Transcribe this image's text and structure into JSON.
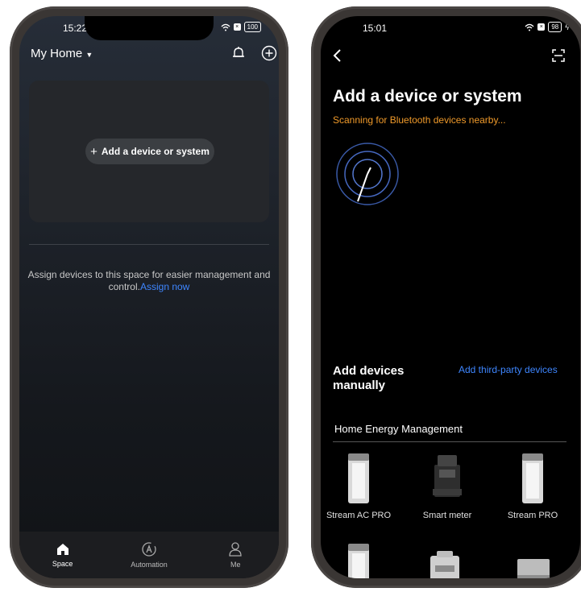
{
  "left_phone": {
    "status_time": "15:22",
    "battery": "100",
    "home_title": "My Home",
    "add_button_label": "Add a device or system",
    "assign_text": "Assign devices to this space for easier management and control.",
    "assign_link": "Assign now",
    "tabs": [
      {
        "label": "Space",
        "icon": "home-icon"
      },
      {
        "label": "Automation",
        "icon": "automation-icon"
      },
      {
        "label": "Me",
        "icon": "user-icon"
      }
    ]
  },
  "right_phone": {
    "status_time": "15:01",
    "battery": "98",
    "title": "Add a device or system",
    "scanning_text": "Scanning for Bluetooth devices nearby...",
    "manual_title": "Add devices manually",
    "third_party_link": "Add third-party devices",
    "section_title": "Home Energy Management",
    "devices": [
      {
        "label": "Stream AC PRO"
      },
      {
        "label": "Smart meter"
      },
      {
        "label": "Stream PRO"
      }
    ]
  },
  "colors": {
    "accent_blue": "#3e86ff",
    "scanning_orange": "#f09a2a"
  }
}
